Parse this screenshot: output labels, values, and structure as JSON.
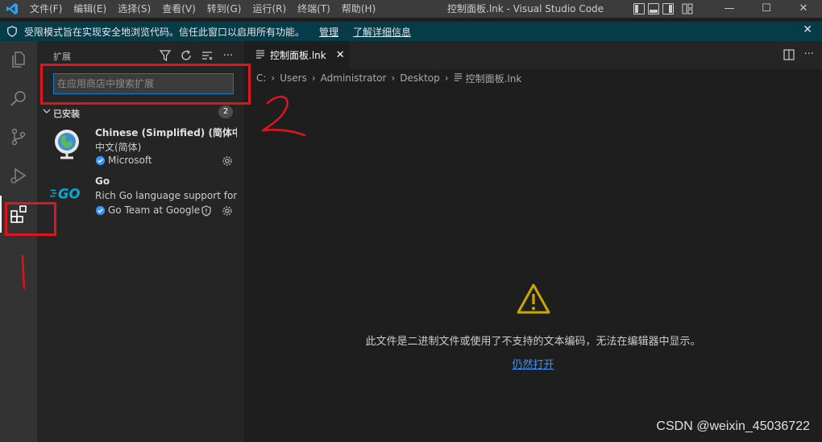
{
  "titlebar": {
    "menu": [
      "文件(F)",
      "编辑(E)",
      "选择(S)",
      "查看(V)",
      "转到(G)",
      "运行(R)",
      "终端(T)",
      "帮助(H)"
    ],
    "title": "控制面板.lnk - Visual Studio Code",
    "window_controls": [
      "—",
      "☐",
      "✕"
    ]
  },
  "banner": {
    "message": "受限模式旨在实现安全地浏览代码。信任此窗口以启用所有功能。",
    "manage_link": "管理",
    "learn_more_link": "了解详细信息",
    "close": "✕"
  },
  "sidebar": {
    "title": "扩展",
    "search_placeholder": "在应用商店中搜索扩展",
    "section": {
      "label": "已安装",
      "count": "2"
    },
    "extensions": [
      {
        "name": "Chinese (Simplified) (简体中文) Language Pack for Visual Studio Code",
        "description": "中文(简体)",
        "publisher": "Microsoft",
        "icon": "globe-icon"
      },
      {
        "name": "Go",
        "description": "Rich Go language support for Visual Studio Code",
        "publisher": "Go Team at Google",
        "icon": "go-logo-icon"
      }
    ]
  },
  "editor": {
    "tab_label": "控制面板.lnk",
    "breadcrumb": [
      "C:",
      "Users",
      "Administrator",
      "Desktop",
      "控制面板.lnk"
    ],
    "message": "此文件是二进制文件或使用了不支持的文本编码，无法在编辑器中显示。",
    "open_anyway": "仍然打开"
  },
  "annotations": {
    "label_1": "1",
    "label_2": "2",
    "color": "#e0141b"
  },
  "watermark": "CSDN @weixin_45036722",
  "colors": {
    "accent": "#007fd4",
    "banner_bg": "#063b49",
    "warning": "#cca700",
    "link": "#3794ff"
  }
}
